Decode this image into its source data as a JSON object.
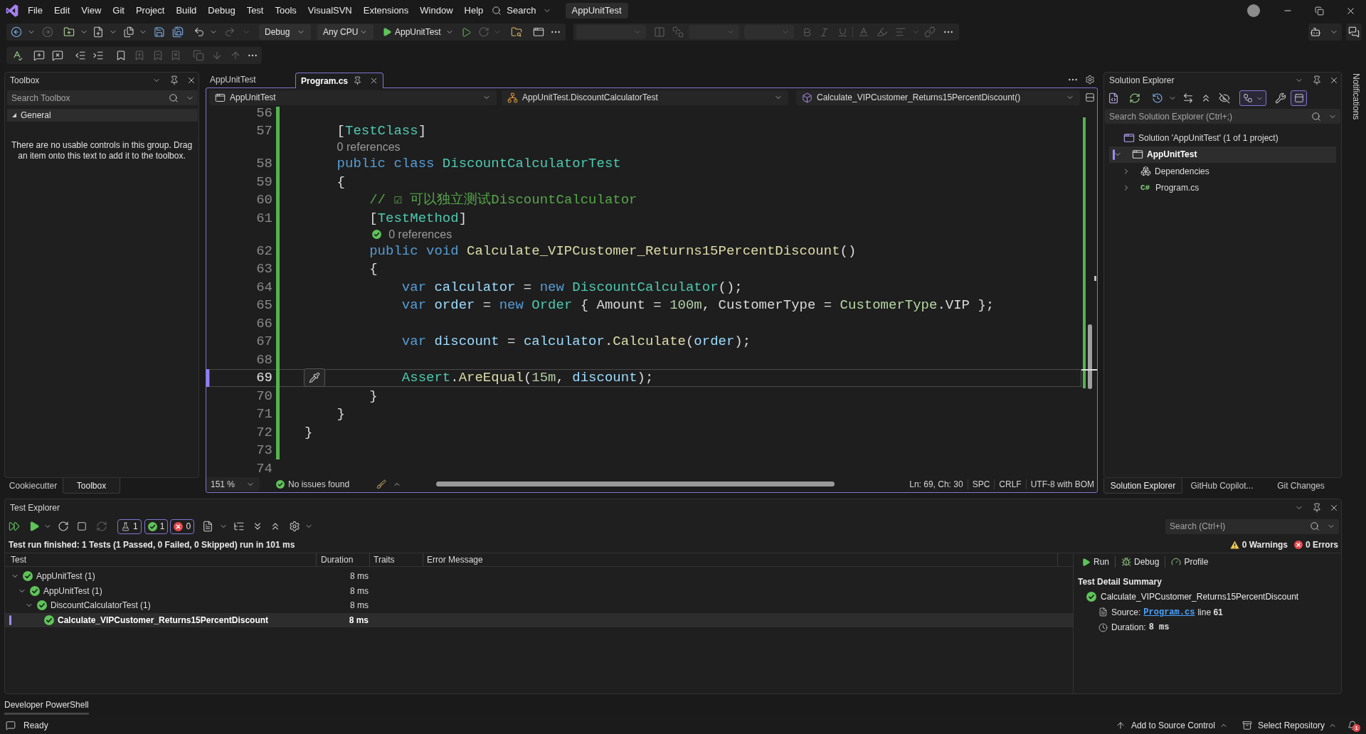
{
  "title_bar": {
    "menu": [
      "File",
      "Edit",
      "View",
      "Git",
      "Project",
      "Build",
      "Debug",
      "Test",
      "Tools",
      "VisualSVN",
      "Extensions",
      "Window",
      "Help"
    ],
    "search": "Search",
    "solution_name": "AppUnitTest"
  },
  "standard_toolbar": {
    "configuration": "Debug",
    "platform": "Any CPU",
    "startup_project": "AppUnitTest"
  },
  "toolbox": {
    "title": "Toolbox",
    "search": {
      "placeholder": "Search Toolbox"
    },
    "group": {
      "label": "General",
      "expanded": true
    },
    "message": "There are no usable controls in this group. Drag an item onto this text to add it to the toolbox."
  },
  "left_dock_tabs": [
    {
      "label": "Cookiecutter",
      "selected": false
    },
    {
      "label": "Toolbox",
      "selected": true
    }
  ],
  "editor": {
    "tabs": [
      {
        "label": "AppUnitTest",
        "selected": false
      },
      {
        "label": "Program.cs",
        "selected": true
      }
    ],
    "navigation": [
      {
        "kind": "project",
        "label": "AppUnitTest"
      },
      {
        "kind": "class",
        "label": "AppUnitTest.DiscountCalculatorTest"
      },
      {
        "kind": "method",
        "label": "Calculate_VIPCustomer_Returns15PercentDiscount()"
      }
    ],
    "lines": [
      {
        "kind": "code",
        "number": "56",
        "changed": true,
        "current": false
      },
      {
        "kind": "code",
        "number": "57",
        "changed": true,
        "current": false,
        "tokens": [
          {
            "text": "    [",
            "kind": "plain"
          },
          {
            "text": "TestClass",
            "kind": "type"
          },
          {
            "text": "]",
            "kind": "plain"
          }
        ]
      },
      {
        "kind": "codelens",
        "text": "    0 references",
        "passed": false
      },
      {
        "kind": "code",
        "number": "58",
        "changed": true,
        "current": false,
        "tokens": [
          {
            "text": "    public class ",
            "kind": "keyword"
          },
          {
            "text": "DiscountCalculatorTest",
            "kind": "type"
          }
        ]
      },
      {
        "kind": "code",
        "number": "59",
        "changed": true,
        "current": false,
        "tokens": [
          {
            "text": "    {",
            "kind": "plain"
          }
        ]
      },
      {
        "kind": "code",
        "number": "60",
        "changed": true,
        "current": false,
        "tokens": [
          {
            "text": "        // ☑ 可以独立测试DiscountCalculator",
            "kind": "comment"
          }
        ]
      },
      {
        "kind": "code",
        "number": "61",
        "changed": true,
        "current": false,
        "tokens": [
          {
            "text": "        [",
            "kind": "plain"
          },
          {
            "text": "TestMethod",
            "kind": "type"
          },
          {
            "text": "]",
            "kind": "plain"
          }
        ]
      },
      {
        "kind": "codelens",
        "text": "        0 references",
        "passed": true
      },
      {
        "kind": "code",
        "number": "62",
        "changed": true,
        "current": false,
        "tokens": [
          {
            "text": "        public void ",
            "kind": "keyword"
          },
          {
            "text": "Calculate_VIPCustomer_Returns15PercentDiscount",
            "kind": "method"
          },
          {
            "text": "()",
            "kind": "plain"
          }
        ]
      },
      {
        "kind": "code",
        "number": "63",
        "changed": true,
        "current": false,
        "tokens": [
          {
            "text": "        {",
            "kind": "plain"
          }
        ]
      },
      {
        "kind": "code",
        "number": "64",
        "changed": true,
        "current": false,
        "tokens": [
          {
            "text": "            var ",
            "kind": "keyword"
          },
          {
            "text": "calculator",
            "kind": "local"
          },
          {
            "text": " = ",
            "kind": "plain"
          },
          {
            "text": "new ",
            "kind": "keyword"
          },
          {
            "text": "DiscountCalculator",
            "kind": "type"
          },
          {
            "text": "();",
            "kind": "plain"
          }
        ]
      },
      {
        "kind": "code",
        "number": "65",
        "changed": true,
        "current": false,
        "tokens": [
          {
            "text": "            var ",
            "kind": "keyword"
          },
          {
            "text": "order",
            "kind": "local"
          },
          {
            "text": " = ",
            "kind": "plain"
          },
          {
            "text": "new ",
            "kind": "keyword"
          },
          {
            "text": "Order",
            "kind": "type"
          },
          {
            "text": " { Amount = ",
            "kind": "plain"
          },
          {
            "text": "100m",
            "kind": "number"
          },
          {
            "text": ", CustomerType = ",
            "kind": "plain"
          },
          {
            "text": "CustomerType",
            "kind": "enum"
          },
          {
            "text": ".VIP };",
            "kind": "plain"
          }
        ]
      },
      {
        "kind": "code",
        "number": "66",
        "changed": true,
        "current": false
      },
      {
        "kind": "code",
        "number": "67",
        "changed": true,
        "current": false,
        "tokens": [
          {
            "text": "            var ",
            "kind": "keyword"
          },
          {
            "text": "discount",
            "kind": "local"
          },
          {
            "text": " = ",
            "kind": "plain"
          },
          {
            "text": "calculator",
            "kind": "local"
          },
          {
            "text": ".",
            "kind": "plain"
          },
          {
            "text": "Calculate",
            "kind": "method"
          },
          {
            "text": "(",
            "kind": "plain"
          },
          {
            "text": "order",
            "kind": "local"
          },
          {
            "text": ");",
            "kind": "plain"
          }
        ]
      },
      {
        "kind": "code",
        "number": "68",
        "changed": true,
        "current": false
      },
      {
        "kind": "code",
        "number": "69",
        "changed": true,
        "current": true,
        "tokens": [
          {
            "text": "            Assert",
            "kind": "type"
          },
          {
            "text": ".",
            "kind": "plain"
          },
          {
            "text": "AreEqual",
            "kind": "method"
          },
          {
            "text": "(",
            "kind": "plain"
          },
          {
            "text": "15m",
            "kind": "number"
          },
          {
            "text": ", ",
            "kind": "plain"
          },
          {
            "text": "discount",
            "kind": "local"
          },
          {
            "text": ");",
            "kind": "plain"
          }
        ]
      },
      {
        "kind": "code",
        "number": "70",
        "changed": true,
        "current": false,
        "tokens": [
          {
            "text": "        }",
            "kind": "plain"
          }
        ]
      },
      {
        "kind": "code",
        "number": "71",
        "changed": true,
        "current": false,
        "tokens": [
          {
            "text": "    }",
            "kind": "plain"
          }
        ]
      },
      {
        "kind": "code",
        "number": "72",
        "changed": true,
        "current": false,
        "tokens": [
          {
            "text": "}",
            "kind": "plain"
          }
        ]
      },
      {
        "kind": "code",
        "number": "73",
        "changed": true,
        "current": false
      },
      {
        "kind": "code",
        "number": "74",
        "changed": false,
        "current": false
      }
    ],
    "status_bar": {
      "zoom": "151 %",
      "issues": "No issues found",
      "position": "Ln: 69, Ch: 30",
      "indentation": "SPC",
      "line_endings": "CRLF",
      "encoding": "UTF-8 with BOM"
    }
  },
  "solution_explorer": {
    "title": "Solution Explorer",
    "toggles": {
      "filter": true,
      "preview": true
    },
    "search": {
      "placeholder": "Search Solution Explorer (Ctrl+;)"
    },
    "tree": [
      {
        "label": "Solution 'AppUnitTest' (1 of 1 project)",
        "kind": "solution",
        "selected": false,
        "children": [
          {
            "label": "AppUnitTest",
            "kind": "project",
            "expanded": true,
            "selected": true,
            "children": [
              {
                "label": "Dependencies",
                "kind": "dependencies",
                "expanded": false,
                "selected": false
              },
              {
                "label": "Program.cs",
                "kind": "source_file",
                "icon_text": "C#",
                "expanded": false,
                "selected": false
              }
            ]
          }
        ]
      }
    ]
  },
  "right_dock_tabs": [
    {
      "label": "Solution Explorer",
      "selected": true
    },
    {
      "label": "GitHub Copilot...",
      "selected": false
    },
    {
      "label": "Git Changes",
      "selected": false
    }
  ],
  "notifications": "Notifications",
  "test_explorer": {
    "title": "Test Explorer",
    "counters": [
      {
        "kind": "total",
        "count": "1"
      },
      {
        "kind": "passed",
        "count": "1"
      },
      {
        "kind": "failed",
        "count": "0"
      }
    ],
    "search": {
      "placeholder": "Search (Ctrl+I)"
    },
    "summary": "Test run finished: 1 Tests (1 Passed, 0 Failed, 0 Skipped) run in 101 ms",
    "warnings": "0 Warnings",
    "errors": "0 Errors",
    "columns": [
      "Test",
      "Duration",
      "Traits",
      "Error Message"
    ],
    "rows": [
      {
        "name": "AppUnitTest (1)",
        "duration": "8 ms",
        "passed": true,
        "expanded": true,
        "selected": false,
        "children": [
          {
            "name": "AppUnitTest (1)",
            "duration": "8 ms",
            "passed": true,
            "expanded": true,
            "selected": false,
            "children": [
              {
                "name": "DiscountCalculatorTest (1)",
                "duration": "8 ms",
                "passed": true,
                "expanded": true,
                "selected": false,
                "children": [
                  {
                    "name": "Calculate_VIPCustomer_Returns15PercentDiscount",
                    "duration": "8 ms",
                    "passed": true,
                    "selected": true
                  }
                ]
              }
            ]
          }
        ]
      }
    ],
    "detail": {
      "actions": [
        {
          "kind": "run",
          "label": "Run"
        },
        {
          "kind": "debug",
          "label": "Debug"
        },
        {
          "kind": "profile",
          "label": "Profile"
        }
      ],
      "heading": "Test Detail Summary",
      "test_name": "Calculate_VIPCustomer_Returns15PercentDiscount",
      "passed": true,
      "source_label": "Source:",
      "source_file": "Program.cs",
      "source_line": "line **61**",
      "duration_label": "Duration:",
      "duration": "8 ms"
    }
  },
  "bottom_panel_tabs": [
    {
      "label": "Developer PowerShell",
      "selected": true
    }
  ],
  "status_bar": {
    "text": "Ready",
    "source_control": "Add to Source Control",
    "repository": "Select Repository",
    "notification_count": "1"
  }
}
